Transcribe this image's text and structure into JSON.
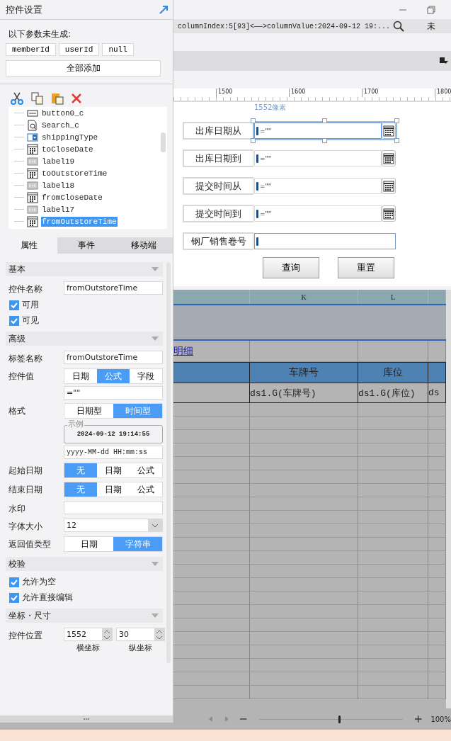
{
  "panel": {
    "title": "控件设置"
  },
  "missing_params": {
    "label": "以下参数未生成:",
    "params": [
      "memberId",
      "userId",
      "null"
    ],
    "add_all": "全部添加"
  },
  "tree": [
    {
      "name": "button0_c",
      "kind": "button",
      "selected": false
    },
    {
      "name": "Search_c",
      "kind": "search",
      "selected": false
    },
    {
      "name": "shippingType",
      "kind": "combo",
      "selected": false
    },
    {
      "name": "toCloseDate",
      "kind": "date",
      "selected": false
    },
    {
      "name": "label19",
      "kind": "label",
      "selected": false
    },
    {
      "name": "toOutstoreTime",
      "kind": "date",
      "selected": false
    },
    {
      "name": "label18",
      "kind": "label",
      "selected": false
    },
    {
      "name": "fromCloseDate",
      "kind": "date",
      "selected": false
    },
    {
      "name": "label17",
      "kind": "label",
      "selected": false
    },
    {
      "name": "fromOutstoreTime",
      "kind": "date",
      "selected": true
    }
  ],
  "tabs": [
    {
      "label": "属性",
      "selected": true
    },
    {
      "label": "事件",
      "selected": false
    },
    {
      "label": "移动端",
      "selected": false
    }
  ],
  "properties": [
    {
      "kind": "section",
      "label": "基本"
    },
    {
      "kind": "text",
      "label": "控件名称",
      "value": "fromOutstoreTime"
    },
    {
      "kind": "checkbox",
      "label": "可用",
      "checked": true
    },
    {
      "kind": "checkbox",
      "label": "可见",
      "checked": true
    },
    {
      "kind": "section",
      "label": "高级"
    },
    {
      "kind": "text",
      "label": "标签名称",
      "value": "fromOutstoreTime"
    },
    {
      "kind": "segmented",
      "label": "控件值",
      "options": [
        {
          "label": "日期",
          "selected": false
        },
        {
          "label": "公式",
          "selected": true
        },
        {
          "label": "字段",
          "selected": false
        }
      ],
      "value": "=\"\""
    },
    {
      "kind": "segmented",
      "label": "格式",
      "options": [
        {
          "label": "日期型",
          "selected": false
        },
        {
          "label": "时间型",
          "selected": true
        }
      ],
      "example": {
        "legend": "示例",
        "value": "2024-09-12 19:14:55"
      },
      "value": "yyyy-MM-dd HH:mm:ss"
    },
    {
      "kind": "segmented",
      "label": "起始日期",
      "options": [
        {
          "label": "无",
          "selected": true
        },
        {
          "label": "日期",
          "selected": false
        },
        {
          "label": "公式",
          "selected": false
        }
      ]
    },
    {
      "kind": "segmented",
      "label": "结束日期",
      "options": [
        {
          "label": "无",
          "selected": true
        },
        {
          "label": "日期",
          "selected": false
        },
        {
          "label": "公式",
          "selected": false
        }
      ]
    },
    {
      "kind": "text",
      "label": "水印"
    },
    {
      "kind": "select",
      "label": "字体大小",
      "value": "12"
    },
    {
      "kind": "segmented",
      "label": "返回值类型",
      "options": [
        {
          "label": "日期",
          "selected": false
        },
        {
          "label": "字符串",
          "selected": true
        }
      ]
    },
    {
      "kind": "section",
      "label": "校验"
    },
    {
      "kind": "checkbox",
      "label": "允许为空",
      "checked": true
    },
    {
      "kind": "checkbox",
      "label": "允许直接编辑",
      "checked": true
    },
    {
      "kind": "section",
      "label": "坐标・尺寸"
    },
    {
      "kind": "spinner",
      "label": "控件位置",
      "values": [
        {
          "value": "1552",
          "caption": "横坐标"
        },
        {
          "value": "30",
          "caption": "纵坐标"
        }
      ]
    }
  ],
  "status": {
    "text": "columnIndex:5[93]<——>columnValue:2024-09-12 19:...",
    "user": "未"
  },
  "ruler": {
    "ticks": [
      "1500",
      "1600",
      "1700",
      "1800"
    ],
    "marker": "1552像素"
  },
  "form": {
    "rows": [
      {
        "label": "出库日期从",
        "kind": "date",
        "value": "=\"\"",
        "selected": true
      },
      {
        "label": "出库日期到",
        "kind": "date",
        "value": "=\"\"",
        "selected": false
      },
      {
        "label": "提交时间从",
        "kind": "date",
        "value": "=\"\"",
        "selected": false
      },
      {
        "label": "提交时间到",
        "kind": "date",
        "value": "=\"\"",
        "selected": false
      },
      {
        "label": "钢厂销售卷号",
        "kind": "text",
        "selected": false
      }
    ],
    "buttons": [
      "查询",
      "重置"
    ]
  },
  "sheet": {
    "column_headers": [
      "K",
      "L"
    ],
    "link": "明细",
    "headers": [
      "车牌号",
      "库位"
    ],
    "cells": [
      "ds1.G(车牌号)",
      "ds1.G(库位)",
      "ds"
    ]
  },
  "zoom_slider": {
    "level": 0.55
  },
  "zoom": "100%"
}
